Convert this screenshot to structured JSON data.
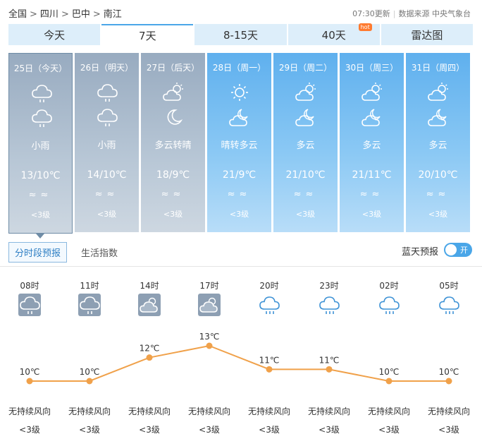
{
  "breadcrumb": [
    "全国",
    "四川",
    "巴中",
    "南江"
  ],
  "breadcrumb_sep": ">",
  "update": {
    "time": "07:30更新",
    "source": "数据来源 中央气象台"
  },
  "tabs": [
    {
      "label": "今天",
      "active": false
    },
    {
      "label": "7天",
      "active": true
    },
    {
      "label": "8-15天",
      "active": false
    },
    {
      "label": "40天",
      "active": false,
      "badge": "hot"
    },
    {
      "label": "雷达图",
      "active": false
    }
  ],
  "days": [
    {
      "date": "25日（今天）",
      "icon_day": "light-rain-icon",
      "icon_night": "light-rain-icon",
      "desc": "小雨",
      "temp": "13/10℃",
      "wind": "≈≈",
      "level": "<3级",
      "style": "grey"
    },
    {
      "date": "26日（明天）",
      "icon_day": "light-rain-icon",
      "icon_night": "light-rain-icon",
      "desc": "小雨",
      "temp": "14/10℃",
      "wind": "≈≈",
      "level": "<3级",
      "style": "grey"
    },
    {
      "date": "27日（后天）",
      "icon_day": "partly-cloudy-icon",
      "icon_night": "moon-icon",
      "desc": "多云转晴",
      "temp": "18/9℃",
      "wind": "≈≈",
      "level": "<3级",
      "style": "grey"
    },
    {
      "date": "28日（周一）",
      "icon_day": "sun-icon",
      "icon_night": "cloudy-night-icon",
      "desc": "晴转多云",
      "temp": "21/9℃",
      "wind": "≈≈",
      "level": "<3级",
      "style": "blue"
    },
    {
      "date": "29日（周二）",
      "icon_day": "partly-cloudy-icon",
      "icon_night": "cloudy-night-icon",
      "desc": "多云",
      "temp": "21/10℃",
      "wind": "≈≈",
      "level": "<3级",
      "style": "blue"
    },
    {
      "date": "30日（周三）",
      "icon_day": "partly-cloudy-icon",
      "icon_night": "cloudy-night-icon",
      "desc": "多云",
      "temp": "21/11℃",
      "wind": "≈≈",
      "level": "<3级",
      "style": "blue"
    },
    {
      "date": "31日（周四）",
      "icon_day": "partly-cloudy-icon",
      "icon_night": "cloudy-night-icon",
      "desc": "多云",
      "temp": "20/10℃",
      "wind": "≈≈",
      "level": "<3级",
      "style": "blue"
    }
  ],
  "subtabs": {
    "hourly": "分时段预报",
    "life": "生活指数"
  },
  "bluesky": {
    "label": "蓝天预报",
    "toggle": "开"
  },
  "hourly": [
    {
      "time": "08时",
      "icon": "rain-tile-icon",
      "temp": 10,
      "temp_label": "10℃",
      "wind_dir": "无持续风向",
      "wind_level": "<3级"
    },
    {
      "time": "11时",
      "icon": "rain-tile-icon",
      "temp": 10,
      "temp_label": "10℃",
      "wind_dir": "无持续风向",
      "wind_level": "<3级"
    },
    {
      "time": "14时",
      "icon": "cloud-tile-icon",
      "temp": 12,
      "temp_label": "12℃",
      "wind_dir": "无持续风向",
      "wind_level": "<3级"
    },
    {
      "time": "17时",
      "icon": "cloud-tile-icon",
      "temp": 13,
      "temp_label": "13℃",
      "wind_dir": "无持续风向",
      "wind_level": "<3级"
    },
    {
      "time": "20时",
      "icon": "rain-outline-icon",
      "temp": 11,
      "temp_label": "11℃",
      "wind_dir": "无持续风向",
      "wind_level": "<3级"
    },
    {
      "time": "23时",
      "icon": "rain-outline-icon",
      "temp": 11,
      "temp_label": "11℃",
      "wind_dir": "无持续风向",
      "wind_level": "<3级"
    },
    {
      "time": "02时",
      "icon": "rain-outline-icon",
      "temp": 10,
      "temp_label": "10℃",
      "wind_dir": "无持续风向",
      "wind_level": "<3级"
    },
    {
      "time": "05时",
      "icon": "rain-outline-icon",
      "temp": 10,
      "temp_label": "10℃",
      "wind_dir": "无持续风向",
      "wind_level": "<3级"
    }
  ],
  "colors": {
    "accent": "#4aa6e8",
    "line": "#f0a14a",
    "grey_day": "#98abc0",
    "blue_day": "#5fb0ee"
  }
}
